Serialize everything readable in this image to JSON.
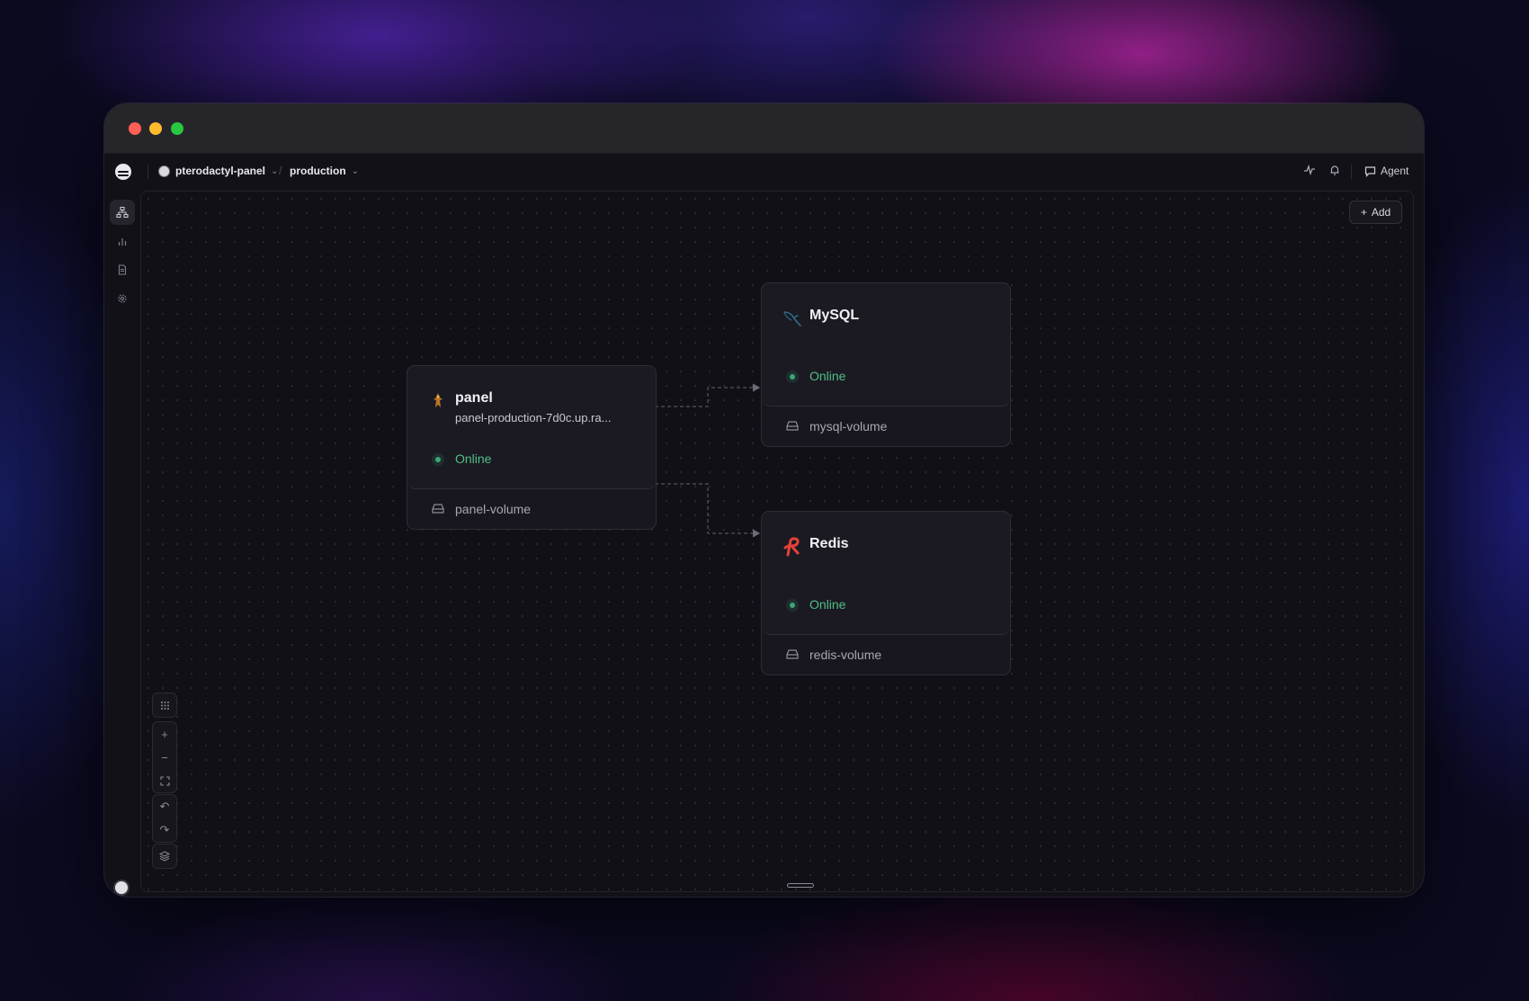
{
  "window": {
    "controls": [
      "close",
      "minimize",
      "maximize"
    ]
  },
  "topbar": {
    "project": "pterodactyl-panel",
    "environment": "production",
    "agent_label": "Agent",
    "icons": [
      "activity-icon",
      "bell-icon",
      "chat-icon"
    ]
  },
  "sidebar": {
    "items": [
      "architecture-icon",
      "metrics-icon",
      "docs-icon",
      "settings-icon"
    ]
  },
  "canvas": {
    "add_label": "Add",
    "nodes": {
      "panel": {
        "title": "panel",
        "url": "panel-production-7d0c.up.ra...",
        "status": "Online",
        "volume": "panel-volume"
      },
      "mysql": {
        "title": "MySQL",
        "status": "Online",
        "volume": "mysql-volume"
      },
      "redis": {
        "title": "Redis",
        "status": "Online",
        "volume": "redis-volume"
      }
    },
    "edges": [
      {
        "from": "panel",
        "to": "mysql"
      },
      {
        "from": "panel",
        "to": "redis"
      }
    ]
  },
  "colors": {
    "status_online": "#4fbf86",
    "redis_brand": "#e5413a",
    "mysql_brand": "#2f6b86"
  }
}
